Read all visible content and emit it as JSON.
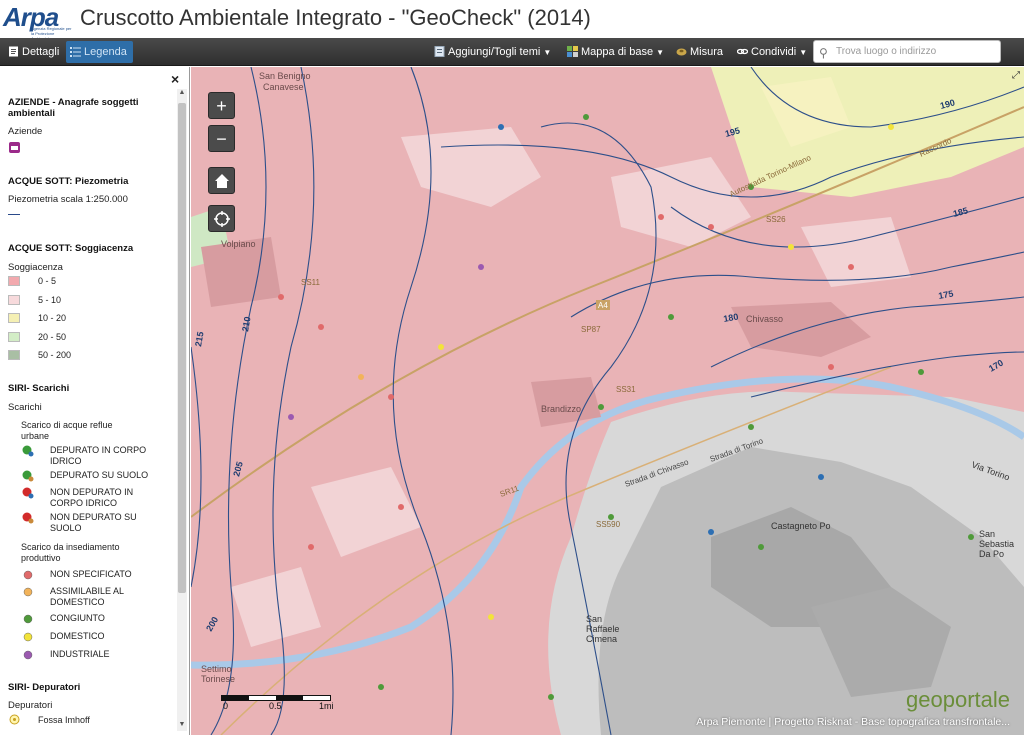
{
  "header": {
    "logo_text": "Arpa",
    "logo_sub": "Agenzia Regionale per la Protezione Ambientale",
    "title": "Cruscotto Ambientale Integrato - \"GeoCheck\" (2014)"
  },
  "toolbar": {
    "details_label": "Dettagli",
    "legend_label": "Legenda",
    "themes_label": "Aggiungi/Togli temi",
    "basemap_label": "Mappa di base",
    "measure_label": "Misura",
    "share_label": "Condividi",
    "search_placeholder": "Trova luogo o indirizzo"
  },
  "legend": {
    "close": "×",
    "aziende_title": "AZIENDE - Anagrafe soggetti ambientali",
    "aziende_sub": "Aziende",
    "piezo_title": "ACQUE SOTT: Piezometria",
    "piezo_sub": "Piezometria scala 1:250.000",
    "sogg_title": "ACQUE SOTT: Soggiacenza",
    "sogg_sub": "Soggiacenza",
    "sogg_classes": [
      {
        "label": "0 - 5",
        "color": "#f2a9ae"
      },
      {
        "label": "5 - 10",
        "color": "#f7dadc"
      },
      {
        "label": "10 - 20",
        "color": "#f5f0b4"
      },
      {
        "label": "20 - 50",
        "color": "#d3edc6"
      },
      {
        "label": "50 - 200",
        "color": "#a9bfa4"
      }
    ],
    "scarichi_title": "SIRI- Scarichi",
    "scarichi_sub": "Scarichi",
    "urbane_title": "Scarico di acque reflue urbane",
    "urbane_items": [
      {
        "label": "DEPURATO IN CORPO IDRICO",
        "c1": "#3a9a3a",
        "c2": "#2d6fb3"
      },
      {
        "label": "DEPURATO SU SUOLO",
        "c1": "#3a9a3a",
        "c2": "#c98a3a"
      },
      {
        "label": "NON DEPURATO IN CORPO IDRICO",
        "c1": "#d22b2b",
        "c2": "#2d6fb3"
      },
      {
        "label": "NON DEPURATO SU SUOLO",
        "c1": "#d22b2b",
        "c2": "#c98a3a"
      }
    ],
    "produttivo_title": "Scarico da insediamento produttivo",
    "produttivo_items": [
      {
        "label": "NON SPECIFICATO",
        "color": "#e06a6a"
      },
      {
        "label": "ASSIMILABILE AL DOMESTICO",
        "color": "#f2b35a"
      },
      {
        "label": "CONGIUNTO",
        "color": "#4f9a3a"
      },
      {
        "label": "DOMESTICO",
        "color": "#f2e33a"
      },
      {
        "label": "INDUSTRIALE",
        "color": "#9b5ab0"
      }
    ],
    "depuratori_title": "SIRI- Depuratori",
    "depuratori_sub": "Depuratori",
    "fossa_label": "Fossa Imhoff"
  },
  "map": {
    "zoom_in": "+",
    "zoom_out": "−",
    "place_names": [
      "San Benigno Canavese",
      "Volpiano",
      "Chivasso",
      "Brandizzo",
      "Castagneto Po",
      "San Raffaele Cimena",
      "Settimo Torinese",
      "San Sebastiano Da Po",
      "Via Torino"
    ],
    "road_labels": [
      "Autostrada Torino-Milano",
      "Raccordo",
      "A4",
      "SP87",
      "SS11",
      "SR11",
      "SS26",
      "SS590",
      "SS31",
      "Strada di Chivasso",
      "Strada di Torino"
    ],
    "contour_labels": [
      "195",
      "190",
      "185",
      "180",
      "175",
      "170",
      "205",
      "210",
      "215",
      "200"
    ],
    "scale_labels": [
      "0",
      "0.5",
      "1mi"
    ],
    "logo": "geoportale",
    "attribution": "Arpa Piemonte | Progetto Risknat - Base topografica transfrontale..."
  }
}
